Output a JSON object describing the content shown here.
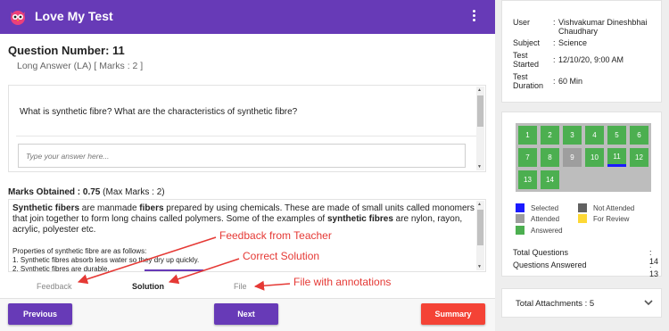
{
  "app": {
    "title": "Love My Test"
  },
  "question": {
    "number_label": "Question Number: 11",
    "type_label": "Long Answer (LA) [ Marks : 2 ]",
    "text": "What is synthetic fibre? What are the  characteristics of synthetic fibre?",
    "answer_placeholder": "Type your answer here..."
  },
  "marks": {
    "label": "Marks Obtained : 0.75",
    "max": "(Max Marks : 2)"
  },
  "solution": {
    "p1": "Synthetic fibers",
    "p2": "  are manmade ",
    "p3": "fibers",
    "p4": " prepared by using chemicals. These are made of small units called monomers that join together to form long chains called polymers. Some of the examples of ",
    "p5": "synthetic fibres",
    "p6": " are nylon, rayon, acrylic, polyester etc.",
    "props_title": "Properties of synthetic fibre are as follows:",
    "prop1": "1. Synthetic fibres absorb less water so they dry up quickly.",
    "prop2": "2. Synthetic fibres are durable."
  },
  "tabs": {
    "feedback": "Feedback",
    "solution": "Solution",
    "file": "File"
  },
  "annotations": {
    "feedback": "Feedback from Teacher",
    "solution": "Correct Solution",
    "file": "File with annotations"
  },
  "buttons": {
    "previous": "Previous",
    "next": "Next",
    "summary": "Summary"
  },
  "info": {
    "user_label": "User",
    "user_value": "Vishvakumar Dineshbhai Chaudhary",
    "subject_label": "Subject",
    "subject_value": "Science",
    "started_label": "Test Started",
    "started_value": "12/10/20, 9:00 AM",
    "duration_label": "Test Duration",
    "duration_value": "60 Min"
  },
  "grid": {
    "cells": [
      {
        "n": "1",
        "status": "answered"
      },
      {
        "n": "2",
        "status": "answered"
      },
      {
        "n": "3",
        "status": "answered"
      },
      {
        "n": "4",
        "status": "answered"
      },
      {
        "n": "5",
        "status": "answered"
      },
      {
        "n": "6",
        "status": "answered"
      },
      {
        "n": "7",
        "status": "answered"
      },
      {
        "n": "8",
        "status": "answered"
      },
      {
        "n": "9",
        "status": "attended"
      },
      {
        "n": "10",
        "status": "answered"
      },
      {
        "n": "11",
        "status": "current"
      },
      {
        "n": "12",
        "status": "answered"
      },
      {
        "n": "13",
        "status": "answered"
      },
      {
        "n": "14",
        "status": "answered"
      }
    ]
  },
  "legend": {
    "selected": "Selected",
    "not_attended": "Not Attended",
    "attended": "Attended",
    "for_review": "For Review",
    "answered": "Answered"
  },
  "totals": {
    "questions_label": "Total Questions",
    "questions_value": ": 14",
    "answered_label": "Questions Answered",
    "answered_value": ": 13"
  },
  "attachments": {
    "label": "Total Attachments : 5"
  },
  "colors": {
    "primary": "#673ab7",
    "danger": "#f44336",
    "answered": "#4caf50",
    "attended": "#9e9e9e",
    "selected": "#1a1aff",
    "not_attended": "#616161",
    "for_review": "#fdd835",
    "annotation": "#e53935"
  }
}
